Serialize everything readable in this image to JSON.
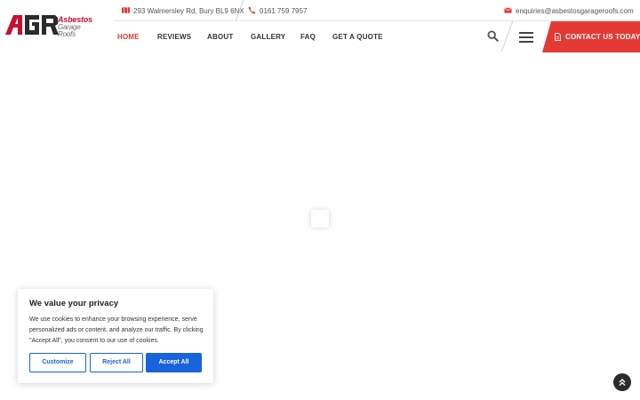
{
  "brand": {
    "logo_mark": "AGR",
    "logo_line1": "Asbestos",
    "logo_line2": "Garage",
    "logo_line3": "Roofs",
    "accent_color": "#e53935"
  },
  "topbar": {
    "address": "293 Walmersley Rd, Bury BL9 6NX",
    "address_icon": "map-icon",
    "phone": "0161 759 7957",
    "phone_icon": "phone-icon",
    "email": "enquiries@asbestosgarageroofs.com",
    "email_icon": "envelope-icon"
  },
  "nav": {
    "items": [
      {
        "label": "HOME",
        "active": true
      },
      {
        "label": "REVIEWS",
        "active": false
      },
      {
        "label": "ABOUT",
        "active": false
      },
      {
        "label": "GALLERY",
        "active": false
      },
      {
        "label": "FAQ",
        "active": false
      },
      {
        "label": "GET A QUOTE",
        "active": false
      }
    ],
    "search_icon": "search-icon",
    "menu_icon": "hamburger-icon",
    "cta_label": "CONTACT US TODAY",
    "cta_icon": "document-icon"
  },
  "cookie": {
    "title": "We value your privacy",
    "text": "We use cookies to enhance your browsing experience, serve personalized ads or content, and analyze our traffic. By clicking \"Accept All\", you consent to our use of cookies.",
    "customize_label": "Customize",
    "reject_label": "Reject All",
    "accept_label": "Accept All",
    "button_color": "#1863dc"
  },
  "back_to_top": {
    "icon": "double-chevron-up-icon"
  }
}
